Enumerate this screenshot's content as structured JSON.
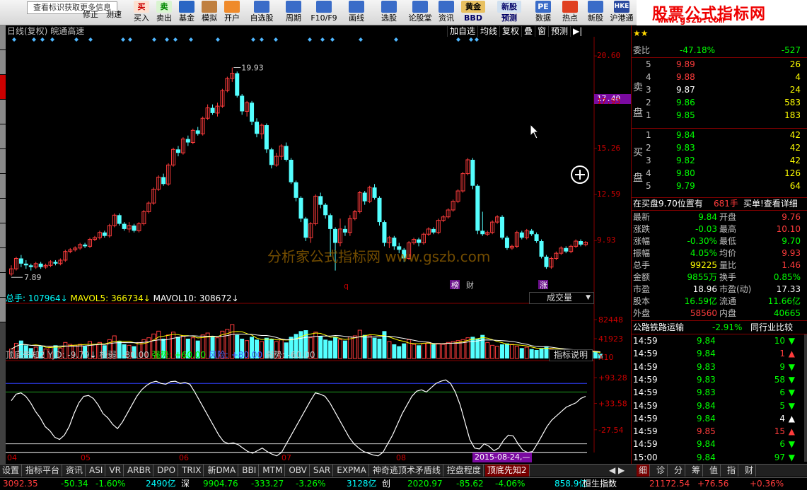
{
  "toolbar": {
    "hint": "查看标识获取更多信息",
    "buttons": [
      {
        "label": "修正"
      },
      {
        "label": "测速"
      },
      {
        "label": "买入"
      },
      {
        "label": "卖出"
      },
      {
        "label": "基金"
      },
      {
        "label": "模拟"
      },
      {
        "label": "开户"
      },
      {
        "label": "自选股"
      },
      {
        "label": "周期"
      },
      {
        "label": "F10/F9"
      },
      {
        "label": "画线"
      },
      {
        "label": "选股"
      },
      {
        "label": "论股堂"
      },
      {
        "label": "资讯"
      },
      {
        "label": "BBD"
      },
      {
        "label": "预测"
      },
      {
        "label": "数据"
      },
      {
        "label": "热点"
      },
      {
        "label": "新股"
      },
      {
        "label": "沪港通"
      }
    ],
    "icon_texts": {
      "buy": "买",
      "sell": "卖",
      "fund": "黄金",
      "news": "新股",
      "pe": "PE",
      "hk": "HKE"
    }
  },
  "brand": {
    "title": "股票公式指标网",
    "url": "www.gszb.com"
  },
  "chart_header": {
    "title": "日线(复权)",
    "stock": "皖通高速",
    "buttons": [
      "加自选",
      "均线",
      "复权",
      "叠",
      "窗",
      "预测",
      "▶|"
    ]
  },
  "chart_data": [
    {
      "type": "candlestick",
      "title": "日线(复权) 皖通高速",
      "yticks": [
        20.6,
        17.93,
        15.26,
        12.59,
        9.93
      ],
      "ylim": [
        7.0,
        21.3
      ],
      "current_price_tag": "17.40",
      "annotations": [
        {
          "text": "19.93"
        },
        {
          "text": "7.89"
        },
        {
          "text": "榜"
        },
        {
          "text": "财"
        },
        {
          "text": "涨"
        },
        {
          "text": "q"
        }
      ],
      "watermark": "分析家公式指标网 www.gszb.com",
      "x_labels": [
        "04",
        "05",
        "06",
        "07",
        "08"
      ],
      "candles": [
        [
          8.0,
          8.3,
          7.89,
          8.5
        ],
        [
          8.3,
          8.9,
          8.2,
          9.0
        ],
        [
          8.9,
          8.6,
          8.4,
          9.1
        ],
        [
          8.6,
          8.5,
          8.3,
          8.8
        ],
        [
          8.5,
          8.4,
          8.2,
          8.6
        ],
        [
          8.4,
          8.6,
          8.3,
          8.7
        ],
        [
          8.6,
          8.4,
          8.3,
          8.7
        ],
        [
          8.4,
          8.5,
          8.3,
          8.6
        ],
        [
          8.5,
          8.7,
          8.4,
          8.8
        ],
        [
          8.7,
          8.6,
          8.5,
          8.8
        ],
        [
          8.6,
          8.8,
          8.5,
          8.9
        ],
        [
          8.8,
          9.3,
          8.7,
          9.4
        ],
        [
          9.3,
          9.4,
          9.2,
          9.5
        ],
        [
          9.4,
          9.5,
          9.3,
          9.6
        ],
        [
          9.5,
          9.7,
          9.4,
          9.8
        ],
        [
          9.7,
          9.6,
          9.5,
          9.8
        ],
        [
          9.6,
          10.0,
          9.5,
          10.1
        ],
        [
          10.0,
          10.1,
          9.9,
          10.2
        ],
        [
          10.1,
          10.4,
          10.0,
          10.5
        ],
        [
          10.4,
          10.2,
          10.1,
          10.5
        ],
        [
          10.2,
          10.8,
          10.1,
          10.9
        ],
        [
          10.8,
          11.4,
          10.7,
          11.5
        ],
        [
          11.4,
          10.9,
          10.8,
          11.5
        ],
        [
          10.9,
          10.6,
          10.5,
          11.0
        ],
        [
          10.6,
          10.8,
          10.4,
          11.0
        ],
        [
          10.8,
          10.5,
          10.4,
          10.9
        ],
        [
          10.5,
          10.9,
          10.4,
          11.0
        ],
        [
          10.9,
          11.6,
          10.8,
          11.7
        ],
        [
          11.6,
          12.1,
          11.5,
          12.2
        ],
        [
          12.1,
          12.9,
          12.0,
          13.0
        ],
        [
          12.9,
          13.6,
          12.8,
          13.7
        ],
        [
          13.6,
          13.2,
          13.1,
          13.8
        ],
        [
          13.2,
          14.3,
          13.1,
          14.4
        ],
        [
          14.3,
          15.2,
          14.2,
          15.3
        ],
        [
          15.2,
          15.0,
          14.8,
          15.4
        ],
        [
          15.0,
          15.8,
          14.9,
          15.9
        ],
        [
          15.8,
          15.6,
          15.4,
          16.0
        ],
        [
          15.6,
          16.3,
          15.5,
          16.4
        ],
        [
          16.3,
          16.1,
          16.0,
          16.5
        ],
        [
          16.1,
          17.0,
          16.0,
          17.1
        ],
        [
          17.0,
          17.6,
          16.9,
          17.8
        ],
        [
          17.6,
          17.3,
          17.2,
          17.8
        ],
        [
          17.3,
          17.7,
          17.1,
          17.9
        ],
        [
          17.7,
          18.6,
          17.6,
          18.7
        ],
        [
          18.6,
          19.3,
          18.5,
          19.4
        ],
        [
          19.3,
          19.6,
          19.1,
          19.93
        ],
        [
          19.6,
          18.3,
          18.2,
          19.7
        ],
        [
          18.3,
          17.4,
          17.2,
          18.4
        ],
        [
          17.4,
          17.9,
          17.1,
          18.0
        ],
        [
          17.9,
          16.8,
          16.6,
          18.0
        ],
        [
          16.8,
          16.1,
          15.9,
          17.0
        ],
        [
          16.1,
          16.6,
          15.8,
          16.7
        ],
        [
          16.6,
          15.2,
          15.0,
          16.7
        ],
        [
          15.2,
          14.3,
          14.1,
          15.3
        ],
        [
          14.3,
          14.8,
          14.2,
          15.0
        ],
        [
          14.8,
          15.4,
          14.6,
          15.5
        ],
        [
          15.4,
          14.6,
          14.5,
          15.6
        ],
        [
          14.6,
          13.3,
          13.2,
          14.7
        ],
        [
          13.3,
          12.4,
          12.2,
          13.4
        ],
        [
          12.4,
          11.2,
          11.0,
          12.5
        ],
        [
          11.2,
          10.1,
          9.9,
          11.3
        ],
        [
          10.1,
          10.9,
          9.8,
          11.0
        ],
        [
          10.9,
          12.5,
          10.8,
          12.6
        ],
        [
          12.5,
          12.0,
          11.8,
          12.7
        ],
        [
          12.0,
          11.4,
          11.2,
          12.1
        ],
        [
          11.4,
          10.6,
          9.0,
          11.5
        ],
        [
          10.6,
          9.8,
          8.2,
          10.7
        ],
        [
          9.8,
          10.6,
          9.6,
          11.2
        ],
        [
          10.6,
          10.4,
          10.2,
          10.8
        ],
        [
          10.4,
          11.2,
          10.2,
          11.4
        ],
        [
          11.2,
          11.6,
          11.1,
          11.7
        ],
        [
          11.6,
          12.7,
          11.5,
          12.8
        ],
        [
          12.7,
          12.2,
          12.0,
          12.8
        ],
        [
          12.2,
          13.0,
          12.1,
          13.1
        ],
        [
          13.0,
          12.4,
          12.3,
          13.2
        ],
        [
          12.4,
          11.0,
          10.8,
          12.5
        ],
        [
          11.0,
          9.8,
          9.6,
          11.1
        ],
        [
          9.8,
          10.1,
          9.5,
          10.2
        ],
        [
          10.1,
          9.6,
          9.4,
          10.2
        ],
        [
          9.6,
          9.4,
          9.2,
          9.8
        ],
        [
          9.4,
          8.9,
          8.7,
          9.5
        ],
        [
          8.9,
          9.8,
          8.8,
          9.9
        ],
        [
          9.8,
          10.0,
          9.7,
          10.1
        ],
        [
          10.0,
          9.8,
          9.6,
          10.1
        ],
        [
          9.8,
          10.3,
          9.7,
          10.4
        ],
        [
          10.3,
          10.6,
          10.2,
          10.7
        ],
        [
          10.6,
          10.4,
          10.3,
          10.7
        ],
        [
          10.4,
          11.1,
          10.3,
          11.2
        ],
        [
          11.1,
          11.3,
          11.0,
          11.4
        ],
        [
          11.3,
          11.7,
          11.2,
          11.8
        ],
        [
          11.7,
          12.2,
          11.6,
          12.3
        ],
        [
          12.2,
          12.8,
          12.1,
          12.9
        ],
        [
          12.8,
          13.8,
          12.7,
          13.9
        ],
        [
          13.8,
          14.6,
          13.7,
          14.7
        ],
        [
          14.6,
          13.1,
          12.9,
          14.7
        ],
        [
          13.1,
          10.5,
          10.3,
          13.2
        ],
        [
          10.5,
          10.3,
          10.2,
          11.6
        ],
        [
          10.3,
          10.4,
          10.2,
          10.5
        ],
        [
          10.4,
          11.0,
          10.3,
          11.1
        ],
        [
          11.0,
          11.3,
          10.9,
          11.4
        ],
        [
          11.3,
          10.1,
          10.0,
          11.4
        ],
        [
          10.1,
          9.5,
          9.4,
          10.2
        ],
        [
          9.5,
          9.6,
          9.4,
          9.7
        ],
        [
          9.6,
          10.4,
          9.5,
          10.5
        ],
        [
          10.4,
          10.1,
          10.0,
          10.5
        ],
        [
          10.1,
          10.5,
          10.0,
          10.6
        ],
        [
          10.5,
          10.3,
          10.2,
          10.6
        ],
        [
          10.3,
          9.9,
          9.8,
          10.4
        ],
        [
          9.9,
          9.0,
          8.9,
          10.0
        ],
        [
          9.0,
          8.4,
          8.3,
          9.1
        ],
        [
          8.4,
          8.9,
          8.3,
          9.0
        ],
        [
          8.9,
          9.2,
          8.8,
          9.3
        ],
        [
          9.2,
          9.5,
          9.1,
          9.6
        ],
        [
          9.5,
          9.3,
          9.2,
          9.6
        ],
        [
          9.3,
          9.6,
          9.2,
          9.7
        ],
        [
          9.6,
          9.9,
          9.5,
          10.0
        ],
        [
          9.9,
          9.7,
          9.6,
          10.0
        ],
        [
          9.7,
          9.84,
          9.6,
          9.9
        ]
      ]
    },
    {
      "type": "bar",
      "title": "成交量",
      "labels": {
        "total": "总手: 107964",
        "mavol5": "MAVOL5: 366734",
        "mavol10": "MAVOL10: 308672"
      },
      "selector": "成交量",
      "yticks": [
        "82448",
        "41923",
        "X10"
      ],
      "ylim": [
        0,
        90000
      ],
      "values": [
        20,
        32,
        38,
        28,
        22,
        24,
        26,
        20,
        24,
        28,
        22,
        34,
        30,
        28,
        30,
        26,
        36,
        30,
        34,
        28,
        40,
        48,
        36,
        30,
        28,
        26,
        34,
        40,
        44,
        52,
        58,
        42,
        50,
        56,
        46,
        48,
        42,
        44,
        38,
        50,
        54,
        46,
        44,
        58,
        62,
        72,
        50,
        42,
        38,
        46,
        40,
        36,
        44,
        42,
        36,
        40,
        34,
        46,
        52,
        58,
        60,
        44,
        56,
        48,
        40,
        38,
        46,
        40,
        38,
        46,
        48,
        60,
        50,
        48,
        44,
        42,
        58,
        36,
        30,
        26,
        32,
        40,
        30,
        28,
        32,
        34,
        30,
        32,
        30,
        34,
        36,
        38,
        40,
        44,
        46,
        42,
        50,
        34,
        28,
        26,
        30,
        32,
        30,
        26,
        22,
        24,
        20,
        18,
        22,
        26,
        20,
        18,
        16,
        14,
        14,
        16,
        15,
        13,
        12,
        14,
        10
      ]
    },
    {
      "type": "line",
      "title": "顶底先知2",
      "labels": {
        "name": "顶底先知2",
        "yjd": "YJD: -9.79",
        "jr": "极弱: -80.00",
        "qs": "强势: +60.00",
        "fx": "风险: +80.00",
        "rs": "弱势: -60.00"
      },
      "button": "指标说明",
      "yticks": [
        "+93.28",
        "+33.58",
        "-27.54"
      ],
      "ylim": [
        -100,
        100
      ],
      "levels": {
        "risk": 80,
        "strong": 60,
        "weak": -60,
        "extreme_weak": -80
      },
      "values": [
        40,
        55,
        58,
        50,
        35,
        15,
        0,
        -20,
        -30,
        -45,
        -50,
        -40,
        -20,
        10,
        35,
        50,
        52,
        45,
        30,
        10,
        0,
        -15,
        -25,
        -10,
        10,
        30,
        50,
        65,
        75,
        82,
        85,
        80,
        78,
        84,
        85,
        80,
        82,
        78,
        60,
        40,
        20,
        0,
        -20,
        -40,
        -55,
        -60,
        -58,
        -62,
        -70,
        -78,
        -82,
        -76,
        -70,
        -78,
        -84,
        -88,
        -80,
        -60,
        -40,
        -20,
        0,
        20,
        40,
        58,
        55,
        50,
        35,
        15,
        -5,
        -25,
        -45,
        -60,
        -70,
        -78,
        -82,
        -86,
        -88,
        -80,
        -60,
        -40,
        -15,
        10,
        30,
        50,
        62,
        65,
        60,
        70,
        80,
        85,
        88,
        80,
        60,
        30,
        -10,
        -50,
        -70,
        -72,
        -60,
        -66,
        -76,
        -70,
        -52,
        -40,
        -42,
        -60,
        -75,
        -80,
        -78,
        -60,
        -40,
        -20,
        -5,
        5,
        15,
        25,
        30,
        35,
        45,
        50
      ]
    }
  ],
  "quote": {
    "wb": {
      "label": "委比",
      "pct": "-47.18%",
      "diff": "-527"
    },
    "sell_label": "卖盘",
    "buy_label": "买盘",
    "sells": [
      {
        "lv": "5",
        "p": "9.89",
        "v": "26"
      },
      {
        "lv": "4",
        "p": "9.88",
        "v": "4"
      },
      {
        "lv": "3",
        "p": "9.87",
        "v": "24"
      },
      {
        "lv": "2",
        "p": "9.86",
        "v": "583"
      },
      {
        "lv": "1",
        "p": "9.85",
        "v": "183"
      }
    ],
    "buys": [
      {
        "lv": "1",
        "p": "9.84",
        "v": "42"
      },
      {
        "lv": "2",
        "p": "9.83",
        "v": "42"
      },
      {
        "lv": "3",
        "p": "9.82",
        "v": "42"
      },
      {
        "lv": "4",
        "p": "9.80",
        "v": "126"
      },
      {
        "lv": "5",
        "p": "9.79",
        "v": "64"
      }
    ],
    "notice": {
      "left": "在买盘9.70位置有",
      "mid": "681手",
      "right": "买单!查看详细"
    },
    "stats": [
      [
        "最新",
        "9.84",
        "开盘",
        "9.76"
      ],
      [
        "涨跌",
        "-0.03",
        "最高",
        "10.10"
      ],
      [
        "涨幅",
        "-0.30%",
        "最低",
        "9.70"
      ],
      [
        "振幅",
        "4.05%",
        "均价",
        "9.93"
      ],
      [
        "总手",
        "99225",
        "量比",
        "1.46"
      ],
      [
        "金额",
        "9855万",
        "换手",
        "0.85%"
      ],
      [
        "市盈",
        "18.96",
        "市盈(动)",
        "17.33"
      ],
      [
        "股本",
        "16.59亿",
        "流通",
        "11.66亿"
      ],
      [
        "外盘",
        "58560",
        "内盘",
        "40665"
      ]
    ],
    "sector": {
      "name": "公路铁路运输",
      "pct": "-2.91%",
      "btn": "同行业比较"
    },
    "ticks": [
      [
        "14:59",
        "9.84",
        "10"
      ],
      [
        "14:59",
        "9.84",
        "1"
      ],
      [
        "14:59",
        "9.83",
        "9"
      ],
      [
        "14:59",
        "9.83",
        "58"
      ],
      [
        "14:59",
        "9.83",
        "6"
      ],
      [
        "14:59",
        "9.84",
        "5"
      ],
      [
        "14:59",
        "9.84",
        "4"
      ],
      [
        "14:59",
        "9.85",
        "15"
      ],
      [
        "14:59",
        "9.84",
        "6"
      ],
      [
        "15:00",
        "9.84",
        "97"
      ]
    ]
  },
  "tabs": [
    "设置",
    "指标平台",
    "资讯",
    "ASI",
    "VR",
    "ARBR",
    "DPO",
    "TRIX",
    "新DMA",
    "BBI",
    "MTM",
    "OBV",
    "SAR",
    "EXPMA",
    "神奇逃顶术矛盾线",
    "控盘程度",
    "顶底先知2"
  ],
  "right_tabs": [
    "细",
    "诊",
    "分",
    "筹",
    "值",
    "指",
    "财"
  ],
  "status": {
    "sh_idx": "3092.35",
    "sh_chg": "-50.34",
    "sh_pct": "-1.60%",
    "sh_amt": "2490亿",
    "sz_label": "深",
    "sz_idx": "9904.76",
    "sz_chg": "-333.27",
    "sz_pct": "-3.26%",
    "sz_amt": "3128亿",
    "cy_label": "创",
    "cy_idx": "2020.97",
    "cy_chg": "-85.62",
    "cy_pct": "-4.06%",
    "hs_amt": "858.9亿",
    "hs_label": "恒生指数",
    "hs_idx": "21172.54",
    "hs_chg": "+76.56",
    "hs_pct": "+0.36%"
  },
  "x_date_tag": "2015-08-24,—"
}
